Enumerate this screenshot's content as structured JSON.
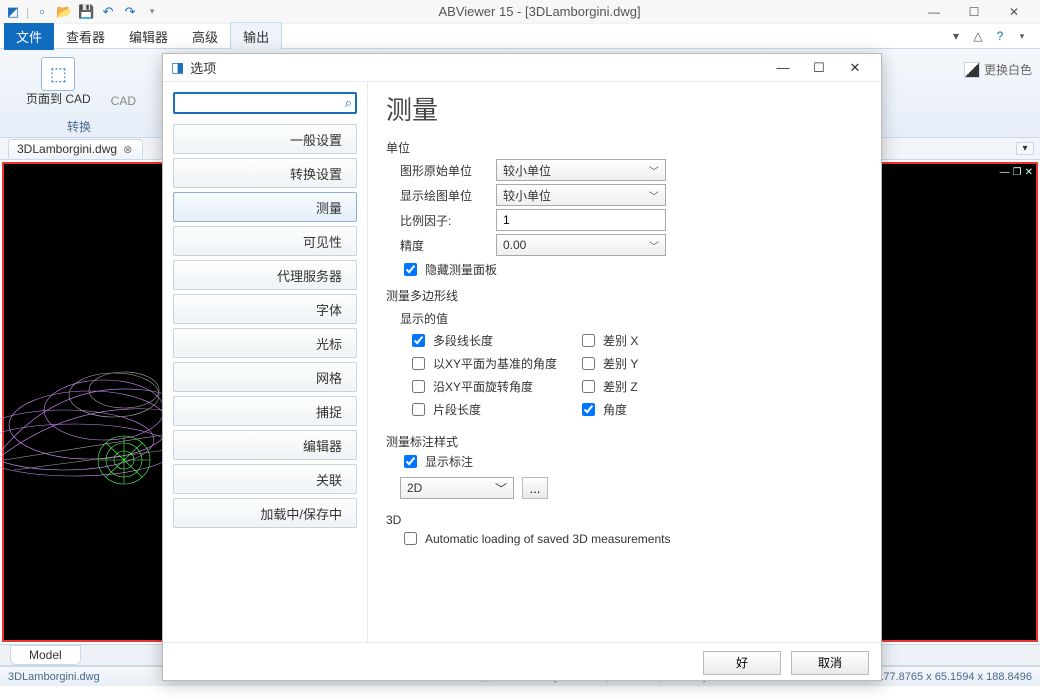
{
  "app": {
    "title": "ABViewer 15 - [3DLamborgini.dwg]"
  },
  "quick_access": [
    "app-icon",
    "new",
    "open",
    "save",
    "undo",
    "redo",
    "sep"
  ],
  "ribbon": {
    "tabs": [
      "文件",
      "查看器",
      "编辑器",
      "高级",
      "输出"
    ],
    "group0_label": "转换",
    "page_to_cad": "页面到 CAD",
    "cad_txt": "CAD"
  },
  "palette_cutoff": "更换白色",
  "doc_tab": "3DLamborgini.dwg",
  "sheet_tab": "Model",
  "status": {
    "file": "3DLamborgini.dwg",
    "page": "1/4",
    "coords": "(-124.9226; 39.04549; 33.1145)",
    "dims": "177.8765 x 65.1594 x 188.8496"
  },
  "dialog": {
    "title": "选项",
    "search_placeholder": "",
    "nav": [
      "一般设置",
      "转换设置",
      "测量",
      "可见性",
      "代理服务器",
      "字体",
      "光标",
      "网格",
      "捕捉",
      "编辑器",
      "关联",
      "加载中/保存中"
    ],
    "nav_selected": 2,
    "h1": "测量",
    "units_title": "单位",
    "f_orig_units": "图形原始单位",
    "v_orig_units": "较小单位",
    "f_disp_units": "显示绘图单位",
    "v_disp_units": "较小单位",
    "f_scale": "比例因子:",
    "v_scale": "1",
    "f_precision": "精度",
    "v_precision": "0.00",
    "cb_hide_panel": "隐藏测量面板",
    "poly_title": "测量多边形线",
    "shown_title": "显示的值",
    "cb_plen": "多段线长度",
    "cb_diffx": "差别 X",
    "cb_xyang": "以XY平面为基准的角度",
    "cb_diffy": "差别 Y",
    "cb_xyrot": "沿XY平面旋转角度",
    "cb_diffz": "差别 Z",
    "cb_seglen": "片段长度",
    "cb_angle": "角度",
    "dim_title": "测量标注样式",
    "cb_showdim": "显示标注",
    "sel_2d": "2D",
    "more_btn": "...",
    "sec_3d": "3D",
    "cb_auto3d": "Automatic loading of saved 3D measurements",
    "ok": "好",
    "cancel": "取消"
  }
}
